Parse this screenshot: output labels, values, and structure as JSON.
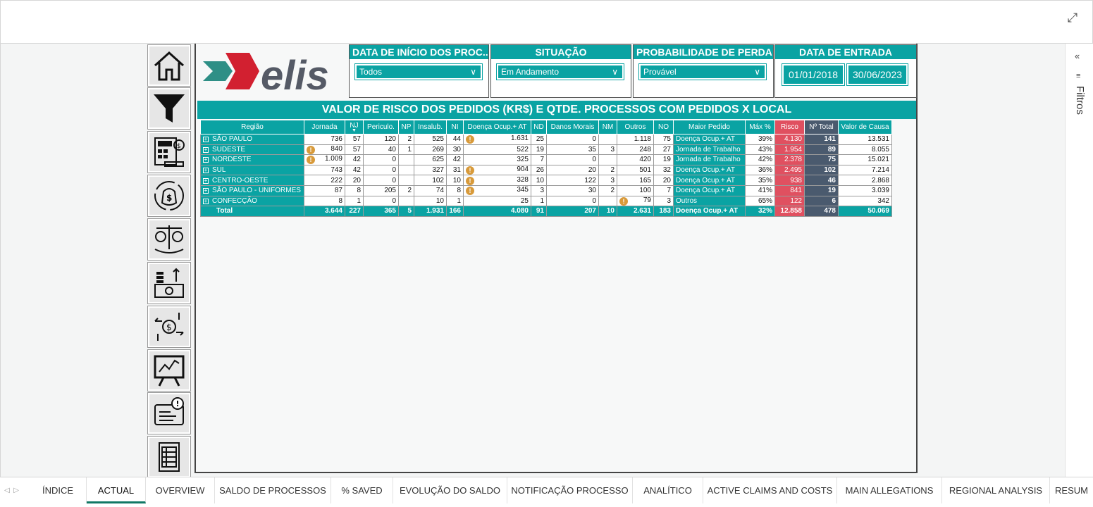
{
  "app": {
    "expand_icon": "expand-icon"
  },
  "filters_pane": {
    "label": "Filtros"
  },
  "slicers": [
    {
      "title": "DATA DE INÍCIO DOS PROC...",
      "value": "Todos"
    },
    {
      "title": "SITUAÇÃO",
      "value": "Em Andamento"
    },
    {
      "title": "PROBABILIDADE DE PERDA",
      "value": "Provável"
    },
    {
      "title": "DATA DE ENTRADA",
      "start": "01/01/2018",
      "end": "30/06/2023"
    }
  ],
  "logo": {
    "text": "elis"
  },
  "matrix": {
    "title": "VALOR DE RISCO DOS PEDIDOS (KR$) E QTDE. PROCESSOS COM PEDIDOS X LOCAL",
    "columns": [
      "Região",
      "Jornada",
      "NJ",
      "Periculo.",
      "NP",
      "Insalub.",
      "NI",
      "Doença Ocup.+ AT",
      "ND",
      "Danos Morais",
      "NM",
      "Outros",
      "NO",
      "Maior Pedido",
      "Máx %",
      "Risco",
      "Nº Total",
      "Valor de Causa"
    ],
    "rows": [
      {
        "regiao": "SÃO PAULO",
        "jornada": "736",
        "nj": "57",
        "peric": "120",
        "np": "2",
        "insal": "525",
        "ni": "44",
        "doenca": "1.631",
        "nd": "25",
        "danos": "0",
        "nm": "",
        "outros": "1.118",
        "no": "75",
        "maior": "Doença Ocup.+ AT",
        "max": "39%",
        "risco": "4.130",
        "total": "141",
        "causa": "13.531"
      },
      {
        "regiao": "SUDESTE",
        "jornada": "840",
        "nj": "57",
        "peric": "40",
        "np": "1",
        "insal": "269",
        "ni": "30",
        "doenca": "522",
        "nd": "19",
        "danos": "35",
        "nm": "3",
        "outros": "248",
        "no": "27",
        "maior": "Jornada de Trabalho",
        "max": "43%",
        "risco": "1.954",
        "total": "89",
        "causa": "8.055"
      },
      {
        "regiao": "NORDESTE",
        "jornada": "1.009",
        "nj": "42",
        "peric": "0",
        "np": "",
        "insal": "625",
        "ni": "42",
        "doenca": "325",
        "nd": "7",
        "danos": "0",
        "nm": "",
        "outros": "420",
        "no": "19",
        "maior": "Jornada de Trabalho",
        "max": "42%",
        "risco": "2.378",
        "total": "75",
        "causa": "15.021"
      },
      {
        "regiao": "SUL",
        "jornada": "743",
        "nj": "42",
        "peric": "0",
        "np": "",
        "insal": "327",
        "ni": "31",
        "doenca": "904",
        "nd": "26",
        "danos": "20",
        "nm": "2",
        "outros": "501",
        "no": "32",
        "maior": "Doença Ocup.+ AT",
        "max": "36%",
        "risco": "2.495",
        "total": "102",
        "causa": "7.214"
      },
      {
        "regiao": "CENTRO-OESTE",
        "jornada": "222",
        "nj": "20",
        "peric": "0",
        "np": "",
        "insal": "102",
        "ni": "10",
        "doenca": "328",
        "nd": "10",
        "danos": "122",
        "nm": "3",
        "outros": "165",
        "no": "20",
        "maior": "Doença Ocup.+ AT",
        "max": "35%",
        "risco": "938",
        "total": "46",
        "causa": "2.868"
      },
      {
        "regiao": "SÃO PAULO - UNIFORMES",
        "jornada": "87",
        "nj": "8",
        "peric": "205",
        "np": "2",
        "insal": "74",
        "ni": "8",
        "doenca": "345",
        "nd": "3",
        "danos": "30",
        "nm": "2",
        "outros": "100",
        "no": "7",
        "maior": "Doença Ocup.+ AT",
        "max": "41%",
        "risco": "841",
        "total": "19",
        "causa": "3.039"
      },
      {
        "regiao": "CONFECÇÃO",
        "jornada": "8",
        "nj": "1",
        "peric": "0",
        "np": "",
        "insal": "10",
        "ni": "1",
        "doenca": "25",
        "nd": "1",
        "danos": "0",
        "nm": "",
        "outros": "79",
        "no": "3",
        "maior": "Outros",
        "max": "65%",
        "risco": "122",
        "total": "6",
        "causa": "342"
      }
    ],
    "totals": {
      "regiao": "Total",
      "jornada": "3.644",
      "nj": "227",
      "peric": "365",
      "np": "5",
      "insal": "1.931",
      "ni": "166",
      "doenca": "4.080",
      "nd": "91",
      "danos": "207",
      "nm": "10",
      "outros": "2.631",
      "no": "183",
      "maior": "Doença Ocup.+ AT",
      "max": "32%",
      "risco": "12.858",
      "total": "478",
      "causa": "50.069"
    }
  },
  "nav_icons": [
    "home-icon",
    "filter-icon",
    "finance-report-icon",
    "money-bag-cycle-icon",
    "scale-money-icon",
    "cash-flow-icon",
    "money-transfer-icon",
    "presentation-chart-icon",
    "alert-message-icon",
    "table-icon"
  ],
  "tabs": [
    "ÍNDICE",
    "ACTUAL",
    "OVERVIEW",
    "SALDO DE PROCESSOS",
    "% SAVED",
    "EVOLUÇÃO DO SALDO",
    "NOTIFICAÇÃO PROCESSO",
    "ANALÍTICO",
    "ACTIVE CLAIMS AND COSTS",
    "MAIN ALLEGATIONS",
    "REGIONAL ANALYSIS",
    "RESUM"
  ],
  "active_tab": "ACTUAL",
  "colors": {
    "teal": "#0aa3a3",
    "risk": "#e05060",
    "total": "#4a5a6e",
    "warn": "#d89a3a",
    "logo_red": "#d22030",
    "logo_gray": "#555a66"
  }
}
